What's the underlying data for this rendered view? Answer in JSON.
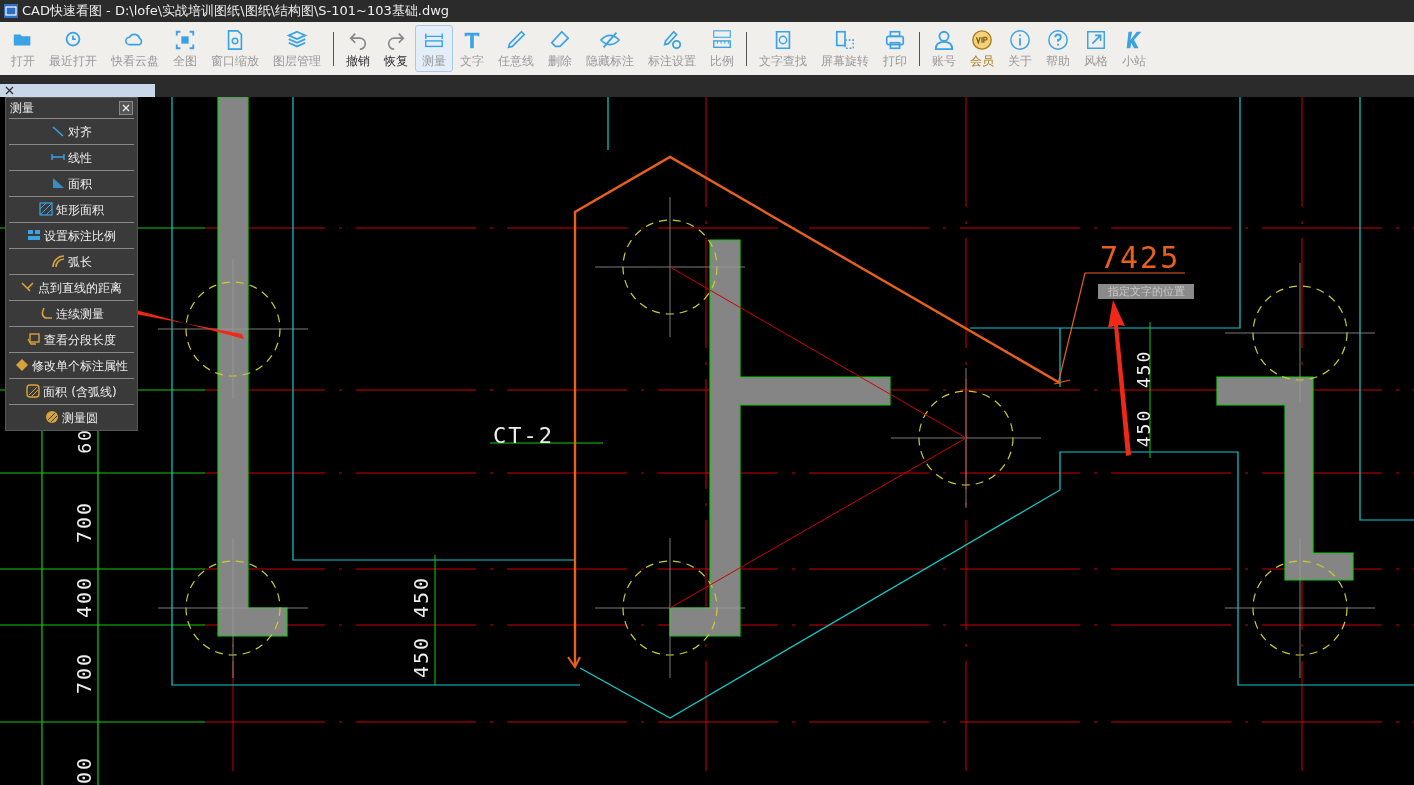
{
  "window": {
    "title": "CAD快速看图 - D:\\lofe\\实战培训图纸\\图纸\\结构图\\S-101~103基础.dwg"
  },
  "toolbar": [
    {
      "kind": "tool",
      "label": "打开",
      "selected": false
    },
    {
      "kind": "tool",
      "label": "最近打开",
      "selected": false
    },
    {
      "kind": "tool",
      "label": "快看云盘",
      "selected": false
    },
    {
      "kind": "tool",
      "label": "全图",
      "selected": false
    },
    {
      "kind": "tool",
      "label": "窗口缩放",
      "selected": false
    },
    {
      "kind": "tool",
      "label": "图层管理",
      "selected": false
    },
    {
      "kind": "separator"
    },
    {
      "kind": "strong",
      "label": "撤销",
      "selected": false
    },
    {
      "kind": "strong",
      "label": "恢复",
      "selected": false
    },
    {
      "kind": "tool",
      "label": "测量",
      "selected": true
    },
    {
      "kind": "tool",
      "label": "文字",
      "selected": false
    },
    {
      "kind": "tool",
      "label": "任意线",
      "selected": false
    },
    {
      "kind": "tool",
      "label": "删除",
      "selected": false
    },
    {
      "kind": "tool",
      "label": "隐藏标注",
      "selected": false
    },
    {
      "kind": "tool",
      "label": "标注设置",
      "selected": false
    },
    {
      "kind": "tool",
      "label": "比例",
      "selected": false
    },
    {
      "kind": "separator"
    },
    {
      "kind": "tool",
      "label": "文字查找",
      "selected": false
    },
    {
      "kind": "tool",
      "label": "屏幕旋转",
      "selected": false
    },
    {
      "kind": "tool",
      "label": "打印",
      "selected": false
    },
    {
      "kind": "separator"
    },
    {
      "kind": "tool",
      "label": "账号",
      "selected": false
    },
    {
      "kind": "vip",
      "label": "会员",
      "selected": false
    },
    {
      "kind": "tool",
      "label": "关于",
      "selected": false
    },
    {
      "kind": "tool",
      "label": "帮助",
      "selected": false
    },
    {
      "kind": "tool",
      "label": "风格",
      "selected": false
    },
    {
      "kind": "tool",
      "label": "小站",
      "selected": false
    }
  ],
  "tabs": [
    {
      "selected": true
    }
  ],
  "measure_panel": {
    "title": "测量",
    "items": [
      "对齐",
      "线性",
      "面积",
      "矩形面积",
      "设置标注比例",
      "弧长",
      "点到直线的距离",
      "连续测量",
      "查看分段长度",
      "修改单个标注属性",
      "面积 (含弧线)",
      "测量圆"
    ]
  },
  "drawing": {
    "labels": [
      {
        "kind": "leader",
        "text": "7425"
      },
      {
        "kind": "plain",
        "text": "CT-2"
      },
      {
        "kind": "dimension",
        "text": "450"
      },
      {
        "kind": "dimension",
        "text": "450"
      },
      {
        "kind": "dimension",
        "text": "60"
      },
      {
        "kind": "dimension",
        "text": "700"
      },
      {
        "kind": "dimension",
        "text": "450"
      },
      {
        "kind": "dimension",
        "text": "400"
      },
      {
        "kind": "dimension",
        "text": "450"
      },
      {
        "kind": "dimension",
        "text": "700"
      },
      {
        "kind": "dimension",
        "text": "00"
      }
    ],
    "tooltip": "指定文字的位置"
  }
}
